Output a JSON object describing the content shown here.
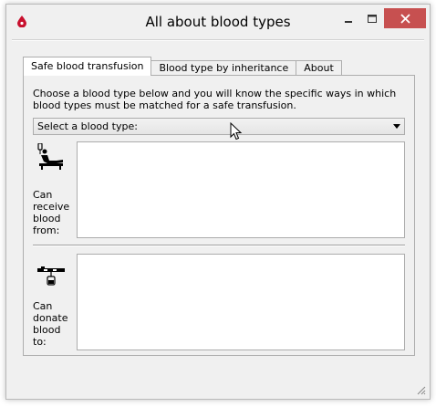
{
  "window": {
    "title": "All about blood types",
    "controls": {
      "minimize": "minimize",
      "maximize": "maximize",
      "close": "close"
    },
    "colors": {
      "close_bg": "#c75050",
      "app_icon": "#c8102e"
    }
  },
  "tabs": [
    {
      "label": "Safe blood transfusion",
      "active": true
    },
    {
      "label": "Blood type by inheritance",
      "active": false
    },
    {
      "label": "About",
      "active": false
    }
  ],
  "panel": {
    "instruction": "Choose a blood type below and you will know the specific ways in which blood types must be matched for a safe transfusion.",
    "select": {
      "value": "Select a blood type:"
    },
    "receive": {
      "label_lines": [
        "Can",
        "receive",
        "blood",
        "from:"
      ],
      "icon": "patient-receiving-icon"
    },
    "donate": {
      "label_lines": [
        "Can",
        "donate",
        "blood",
        "to:"
      ],
      "icon": "blood-bag-icon"
    }
  }
}
